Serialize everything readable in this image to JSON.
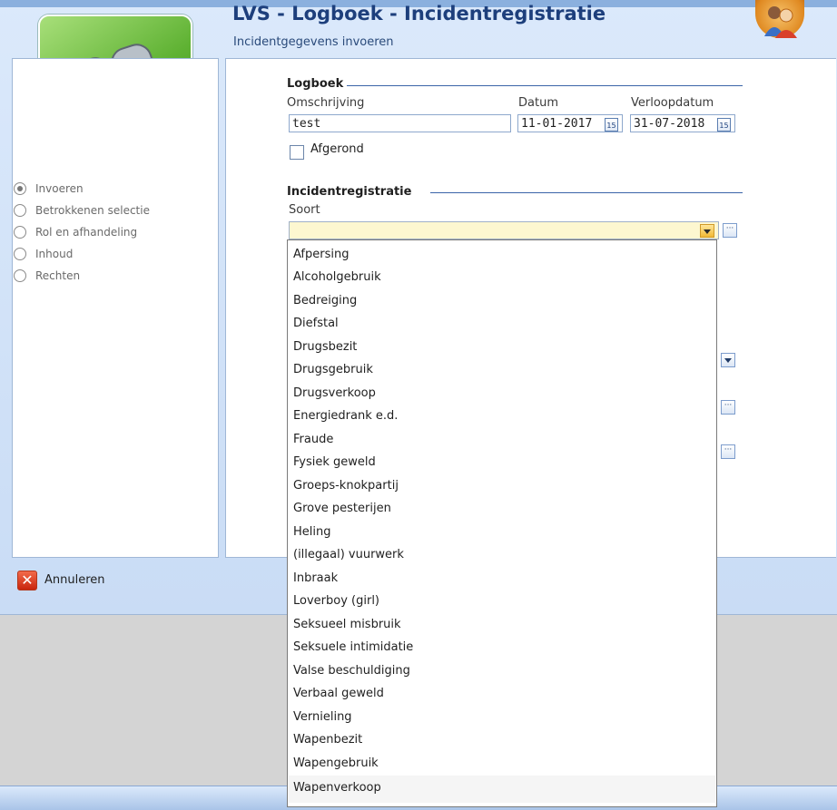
{
  "header": {
    "title": "LVS - Logboek - Incidentregistratie",
    "subtitle": "Incidentgegevens invoeren"
  },
  "steps": [
    {
      "label": "Invoeren",
      "selected": true
    },
    {
      "label": "Betrokkenen selectie",
      "selected": false
    },
    {
      "label": "Rol en afhandeling",
      "selected": false
    },
    {
      "label": "Inhoud",
      "selected": false
    },
    {
      "label": "Rechten",
      "selected": false
    }
  ],
  "logboek": {
    "legend": "Logboek",
    "omschrijving_label": "Omschrijving",
    "omschrijving_value": "test",
    "datum_label": "Datum",
    "datum_value": "11-01-2017",
    "verloopdatum_label": "Verloopdatum",
    "verloopdatum_value": "31-07-2018",
    "calendar_glyph": "15",
    "afgerond_label": "Afgerond",
    "afgerond_checked": false
  },
  "incident": {
    "legend": "Incidentregistratie",
    "soort_label": "Soort",
    "soort_value": ""
  },
  "footer": {
    "cancel_label": "Annuleren"
  },
  "soort_options": [
    "Afpersing",
    "Alcoholgebruik",
    "Bedreiging",
    "Diefstal",
    "Drugsbezit",
    "Drugsgebruik",
    "Drugsverkoop",
    "Energiedrank e.d.",
    "Fraude",
    "Fysiek geweld",
    "Groeps-knokpartij",
    "Grove pesterijen",
    "Heling",
    "(illegaal) vuurwerk",
    "Inbraak",
    "Loverboy (girl)",
    "Seksueel misbruik",
    "Seksuele intimidatie",
    "Valse beschuldiging",
    "Verbaal geweld",
    "Vernieling",
    "Wapenbezit",
    "Wapengebruik",
    "Wapenverkoop"
  ],
  "icons": {
    "logo": "binoculars-icon",
    "avatar": "users-icon",
    "cancel": "close-icon",
    "calendar": "calendar-icon",
    "ellipsis": "ellipsis-icon",
    "dropdown": "chevron-down-icon"
  },
  "colors": {
    "title": "#1d3f7c",
    "logo_green": "#5fb233",
    "field_highlight": "#fdf7d0",
    "cancel_red": "#c9250d"
  }
}
